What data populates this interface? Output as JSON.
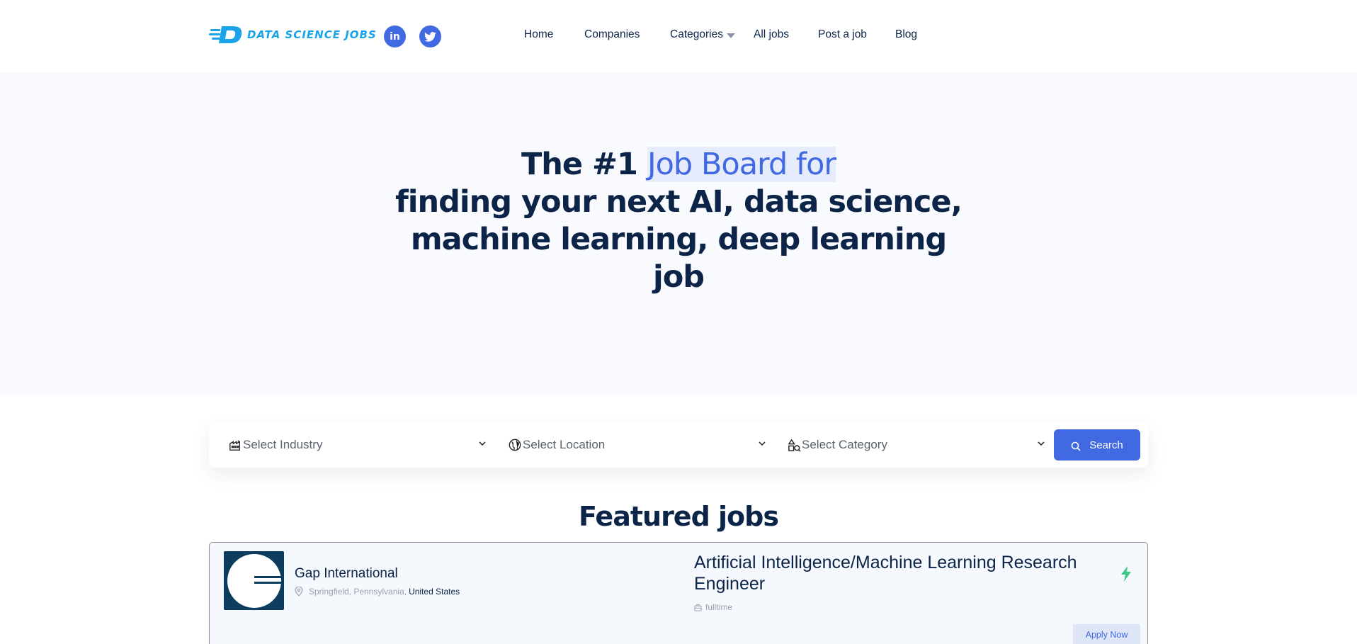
{
  "header": {
    "logo_text": "DATA SCIENCE JOBS",
    "social": [
      {
        "icon": "linkedin-icon",
        "glyph": "in"
      },
      {
        "icon": "twitter-icon"
      }
    ],
    "nav": {
      "home": "Home",
      "companies": "Companies",
      "categories": "Categories",
      "all_jobs": "All jobs",
      "post_job": "Post a job",
      "blog": "Blog"
    }
  },
  "hero": {
    "prefix": "The #1 ",
    "highlight": "Job Board for",
    "rest": "finding your next AI, data science, machine learning, deep learning job"
  },
  "search": {
    "industry_placeholder": "Select Industry",
    "location_placeholder": "Select Location",
    "category_placeholder": "Select Category",
    "button_label": "Search"
  },
  "featured": {
    "title": "Featured jobs",
    "jobs": [
      {
        "company": "Gap International",
        "location_city": "Springfield, Pennsylvania,",
        "location_country": "United States",
        "title": "Artificial Intelligence/Machine Learning Research Engineer",
        "type": "fulltime",
        "apply_label": "Apply Now"
      }
    ]
  },
  "colors": {
    "accent": "#4169e1",
    "navy": "#0b2447",
    "logo_blue": "#1aa3e8",
    "featured_bolt": "#3cc98a",
    "hero_bg": "#f8fafd"
  }
}
